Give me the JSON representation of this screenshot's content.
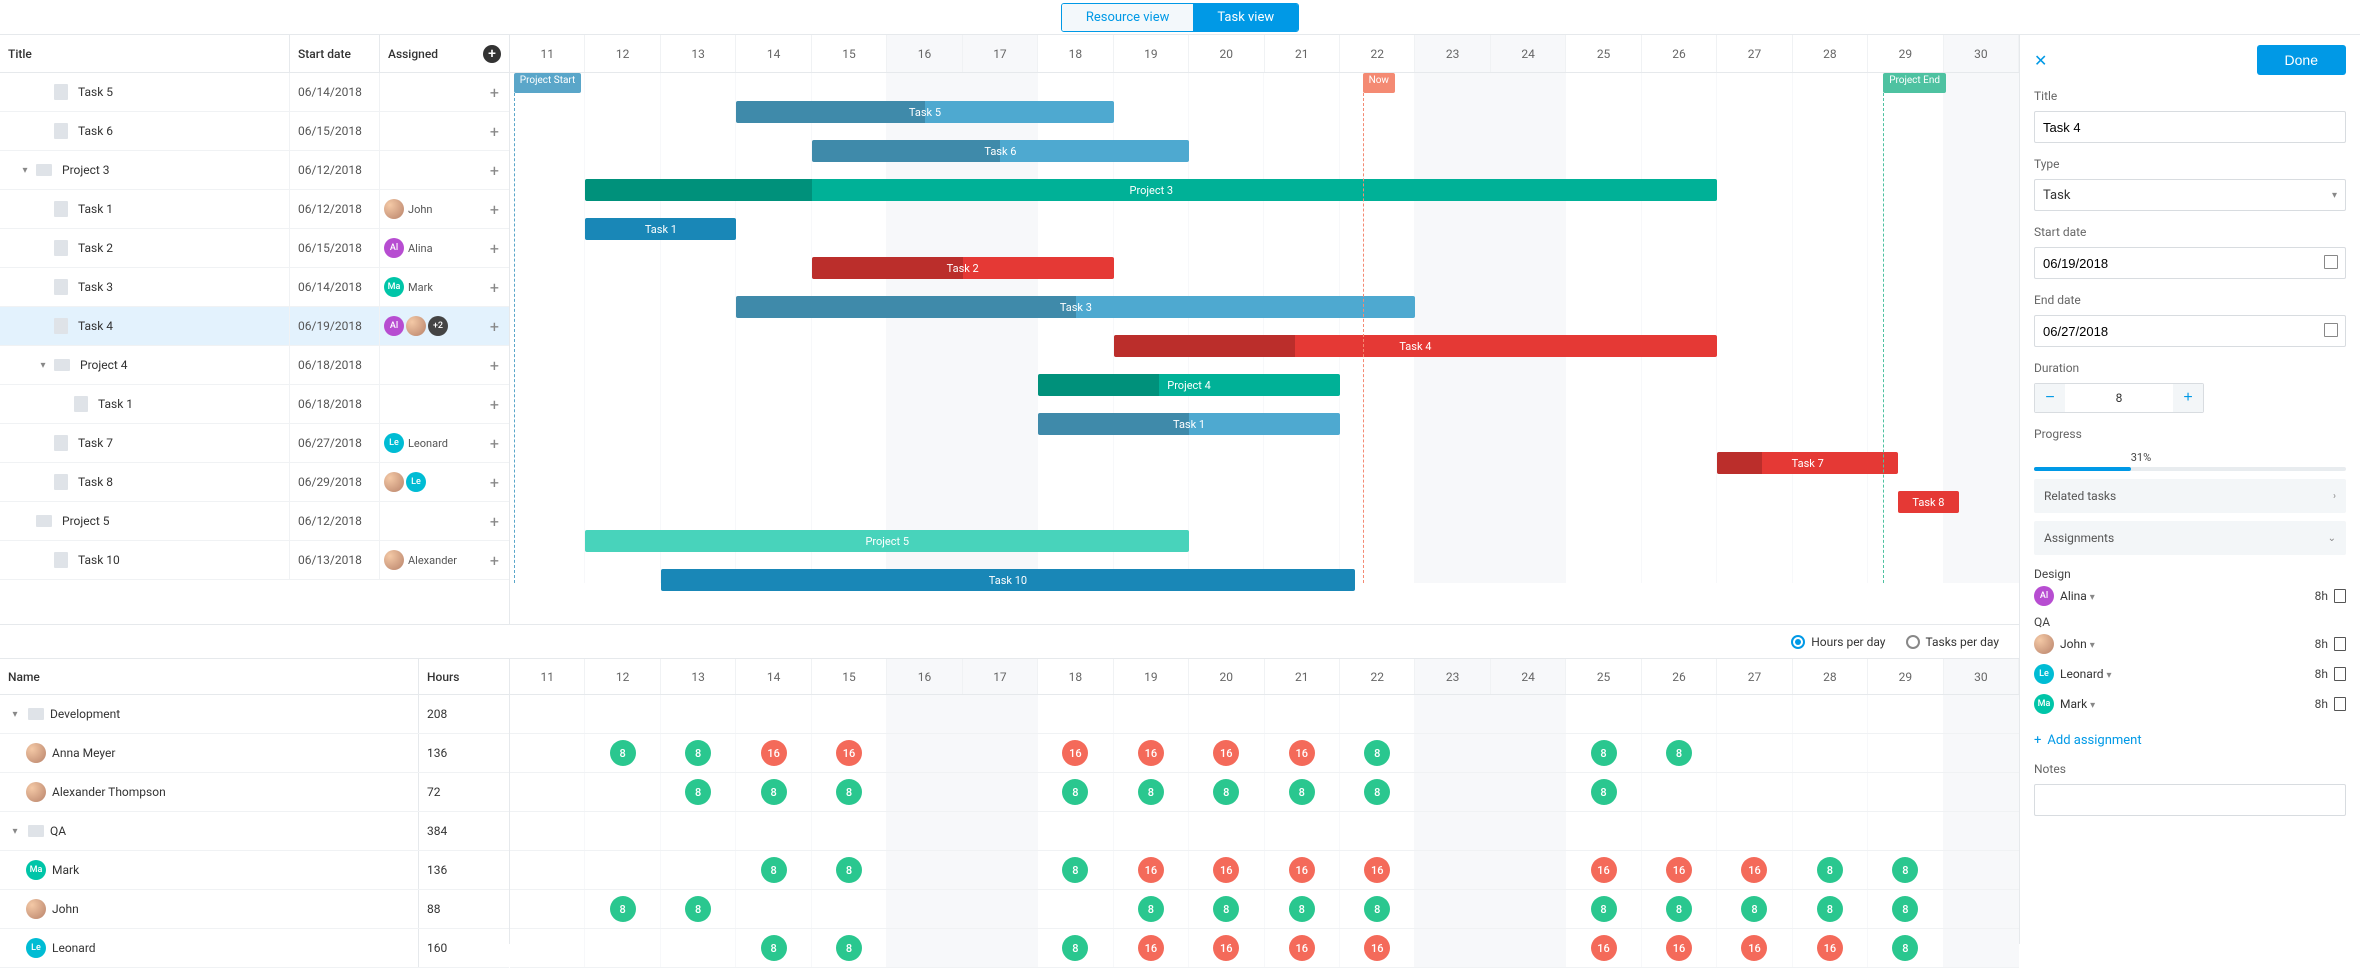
{
  "tabs": {
    "resource": "Resource view",
    "task": "Task view"
  },
  "columns": {
    "title": "Title",
    "start": "Start date",
    "assigned": "Assigned"
  },
  "days": [
    "11",
    "12",
    "13",
    "14",
    "15",
    "16",
    "17",
    "18",
    "19",
    "20",
    "21",
    "22",
    "23",
    "24",
    "25",
    "26",
    "27",
    "28",
    "29",
    "30"
  ],
  "weekend_indices": [
    5,
    6,
    12,
    13,
    19
  ],
  "markers": {
    "start": "Project Start",
    "now": "Now",
    "end": "Project End"
  },
  "tasks": [
    {
      "id": "t5",
      "title": "Task 5",
      "date": "06/14/2018",
      "indent": 1,
      "type": "file",
      "bar": {
        "start": 3,
        "span": 5,
        "color": "blue",
        "label": "Task 5",
        "prog": 0.5
      }
    },
    {
      "id": "t6",
      "title": "Task 6",
      "date": "06/15/2018",
      "indent": 1,
      "type": "file",
      "bar": {
        "start": 4,
        "span": 5,
        "color": "blue",
        "label": "Task 6",
        "prog": 0.5
      }
    },
    {
      "id": "p3",
      "title": "Project 3",
      "date": "06/12/2018",
      "indent": 0,
      "type": "folder",
      "chevron": true,
      "bar": {
        "start": 1,
        "span": 15,
        "color": "teal",
        "label": "Project 3",
        "prog": 0.2
      }
    },
    {
      "id": "t1",
      "title": "Task 1",
      "date": "06/12/2018",
      "indent": 1,
      "type": "file",
      "assigned": [
        {
          "av": "photo",
          "name": "John"
        }
      ],
      "bar": {
        "start": 1,
        "span": 2,
        "color": "blue-dark",
        "label": "Task 1",
        "prog": 1
      }
    },
    {
      "id": "t2",
      "title": "Task 2",
      "date": "06/15/2018",
      "indent": 1,
      "type": "file",
      "assigned": [
        {
          "av": "al",
          "name": "Alina"
        }
      ],
      "bar": {
        "start": 4,
        "span": 4,
        "color": "red",
        "label": "Task 2",
        "prog": 0.5
      }
    },
    {
      "id": "t3",
      "title": "Task 3",
      "date": "06/14/2018",
      "indent": 1,
      "type": "file",
      "assigned": [
        {
          "av": "ma",
          "name": "Mark"
        }
      ],
      "bar": {
        "start": 3,
        "span": 9,
        "color": "blue",
        "label": "Task 3",
        "prog": 0.5
      }
    },
    {
      "id": "t4",
      "title": "Task 4",
      "date": "06/19/2018",
      "indent": 1,
      "type": "file",
      "selected": true,
      "assigned": [
        {
          "av": "al"
        },
        {
          "av": "photo"
        },
        {
          "av": "plus",
          "name": "+2"
        }
      ],
      "bar": {
        "start": 8,
        "span": 8,
        "color": "red",
        "label": "Task 4",
        "prog": 0.3
      }
    },
    {
      "id": "p4",
      "title": "Project 4",
      "date": "06/18/2018",
      "indent": 1,
      "type": "folder",
      "chevron": true,
      "bar": {
        "start": 7,
        "span": 4,
        "color": "teal",
        "label": "Project 4",
        "prog": 0.4
      }
    },
    {
      "id": "p4t1",
      "title": "Task 1",
      "date": "06/18/2018",
      "indent": 2,
      "type": "file",
      "bar": {
        "start": 7,
        "span": 4,
        "color": "blue",
        "label": "Task 1",
        "prog": 0.5
      }
    },
    {
      "id": "t7",
      "title": "Task 7",
      "date": "06/27/2018",
      "indent": 1,
      "type": "file",
      "assigned": [
        {
          "av": "le",
          "name": "Leonard"
        }
      ],
      "bar": {
        "start": 16,
        "span": 2.4,
        "color": "red",
        "label": "Task 7",
        "prog": 0.25
      }
    },
    {
      "id": "t8",
      "title": "Task 8",
      "date": "06/29/2018",
      "indent": 1,
      "type": "file",
      "assigned": [
        {
          "av": "photo"
        },
        {
          "av": "le"
        }
      ],
      "bar": {
        "start": 18.4,
        "span": 0.8,
        "color": "red",
        "label": "Task 8",
        "prog": 0
      }
    },
    {
      "id": "p5",
      "title": "Project 5",
      "date": "06/12/2018",
      "indent": 0,
      "type": "folder",
      "bar": {
        "start": 1,
        "span": 8,
        "color": "teal-light",
        "label": "Project 5",
        "prog": 0
      }
    },
    {
      "id": "t10",
      "title": "Task 10",
      "date": "06/13/2018",
      "indent": 1,
      "type": "file",
      "assigned": [
        {
          "av": "photo",
          "name": "Alexander"
        }
      ],
      "bar": {
        "start": 2,
        "span": 9.2,
        "color": "blue-dark",
        "label": "Task 10",
        "prog": 0
      }
    }
  ],
  "workload_toggle": {
    "hours": "Hours per day",
    "tasks": "Tasks per day"
  },
  "workload_head": {
    "name": "Name",
    "hours": "Hours"
  },
  "workload": [
    {
      "name": "Development",
      "hours": "208",
      "group": true,
      "indent": 0,
      "cells": []
    },
    {
      "name": "Anna Meyer",
      "hours": "136",
      "av": "photo",
      "indent": 1,
      "cells": {
        "1": "8g",
        "2": "8g",
        "3": "16r",
        "4": "16r",
        "7": "16r",
        "8": "16r",
        "9": "16r",
        "10": "16r",
        "11": "8g",
        "14": "8g",
        "15": "8g"
      }
    },
    {
      "name": "Alexander Thompson",
      "hours": "72",
      "av": "photo",
      "indent": 1,
      "cells": {
        "2": "8g",
        "3": "8g",
        "4": "8g",
        "7": "8g",
        "8": "8g",
        "9": "8g",
        "10": "8g",
        "11": "8g",
        "14": "8g"
      }
    },
    {
      "name": "QA",
      "hours": "384",
      "group": true,
      "indent": 0,
      "cells": []
    },
    {
      "name": "Mark",
      "hours": "136",
      "av": "ma",
      "indent": 1,
      "cells": {
        "3": "8g",
        "4": "8g",
        "7": "8g",
        "8": "16r",
        "9": "16r",
        "10": "16r",
        "11": "16r",
        "14": "16r",
        "15": "16r",
        "16": "16r",
        "17": "8g",
        "18": "8g"
      }
    },
    {
      "name": "John",
      "hours": "88",
      "av": "photo",
      "indent": 1,
      "cells": {
        "1": "8g",
        "2": "8g",
        "8": "8g",
        "9": "8g",
        "10": "8g",
        "11": "8g",
        "14": "8g",
        "15": "8g",
        "16": "8g",
        "17": "8g",
        "18": "8g"
      }
    },
    {
      "name": "Leonard",
      "hours": "160",
      "av": "le",
      "indent": 1,
      "cells": {
        "3": "8g",
        "4": "8g",
        "7": "8g",
        "8": "16r",
        "9": "16r",
        "10": "16r",
        "11": "16r",
        "14": "16r",
        "15": "16r",
        "16": "16r",
        "17": "16r",
        "18": "8g"
      }
    }
  ],
  "panel": {
    "done": "Done",
    "title_label": "Title",
    "title": "Task 4",
    "type_label": "Type",
    "type": "Task",
    "start_label": "Start date",
    "start": "06/19/2018",
    "end_label": "End date",
    "end": "06/27/2018",
    "duration_label": "Duration",
    "duration": "8",
    "progress_label": "Progress",
    "progress_pct": "31%",
    "progress_val": 31,
    "related": "Related tasks",
    "assignments_label": "Assignments",
    "groups": [
      {
        "label": "Design",
        "rows": [
          {
            "av": "al",
            "name": "Alina",
            "hrs": "8h"
          }
        ]
      },
      {
        "label": "QA",
        "rows": [
          {
            "av": "photo",
            "name": "John",
            "hrs": "8h"
          },
          {
            "av": "le",
            "name": "Leonard",
            "hrs": "8h"
          },
          {
            "av": "ma",
            "name": "Mark",
            "hrs": "8h"
          }
        ]
      }
    ],
    "add_assignment": "Add assignment",
    "notes_label": "Notes"
  }
}
